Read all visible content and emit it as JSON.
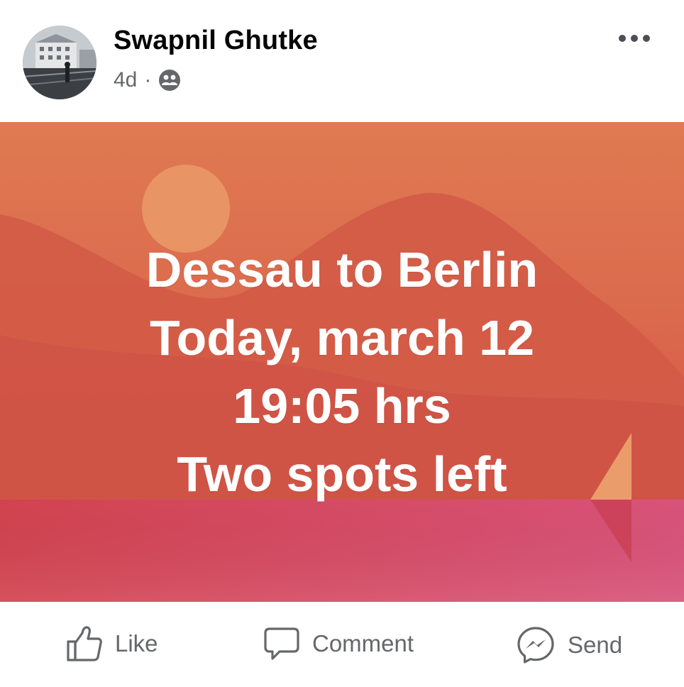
{
  "post": {
    "author": "Swapnil Ghutke",
    "time": "4d",
    "separator": "·",
    "audience_icon": "friends-icon",
    "more_icon": "more-options-icon",
    "lines": [
      "Dessau to Berlin",
      "Today, march 12",
      "19:05 hrs",
      "Two spots left"
    ],
    "colors": {
      "background_top": "#df7a52",
      "background_mid": "#d65547",
      "background_bottom": "#d94a6a",
      "text": "#ffffff"
    }
  },
  "actions": {
    "like_label": "Like",
    "comment_label": "Comment",
    "send_label": "Send",
    "like_icon": "thumbs-up-icon",
    "comment_icon": "comment-icon",
    "send_icon": "messenger-icon"
  }
}
